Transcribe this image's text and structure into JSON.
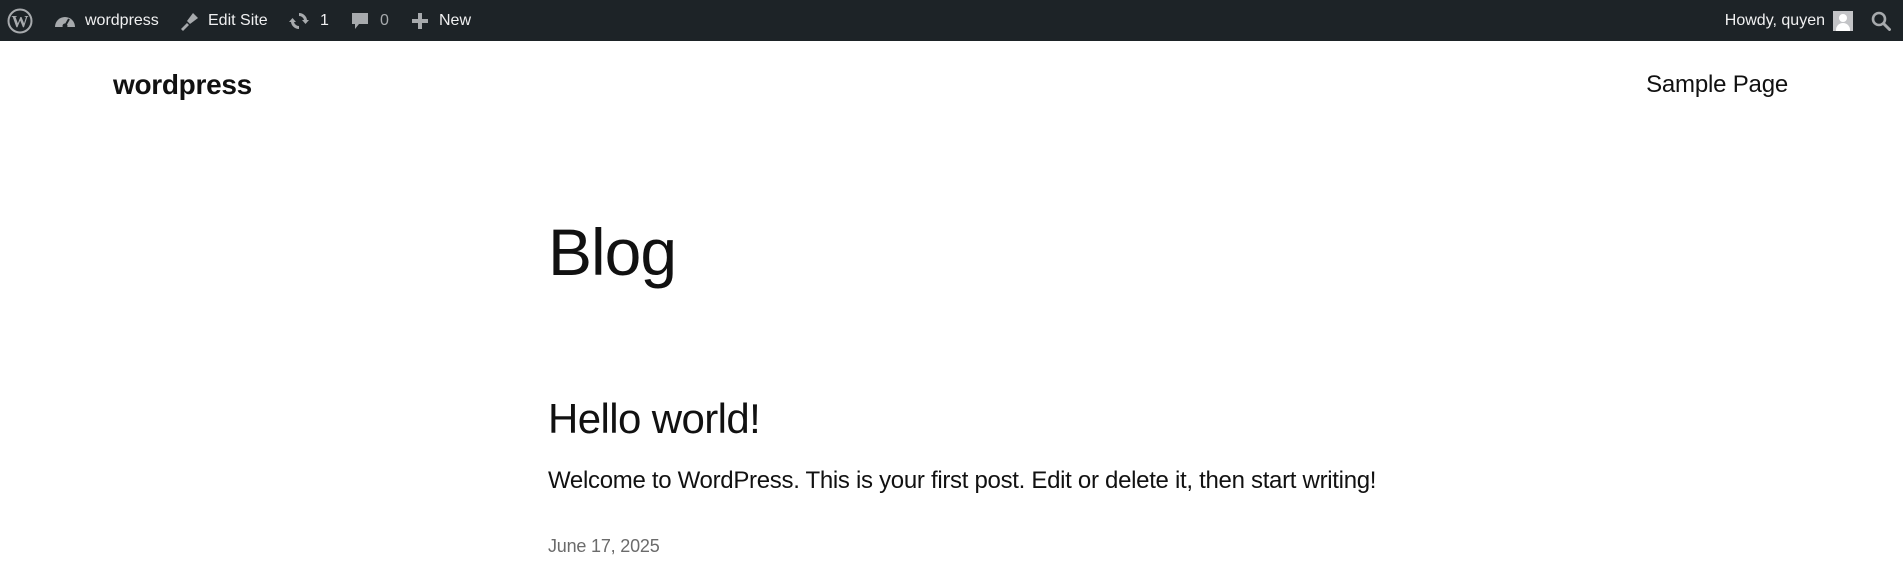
{
  "adminbar": {
    "site_name": "wordpress",
    "edit_site": "Edit Site",
    "updates_count": "1",
    "comments_count": "0",
    "new_label": "New",
    "greeting": "Howdy, quyen"
  },
  "site": {
    "title": "wordpress",
    "nav_items": [
      "Sample Page"
    ]
  },
  "main": {
    "page_title": "Blog",
    "posts": [
      {
        "title": "Hello world!",
        "excerpt": "Welcome to WordPress. This is your first post. Edit or delete it, then start writing!",
        "date": "June 17, 2025"
      }
    ]
  },
  "colors": {
    "adminbar_bg": "#1d2327",
    "adminbar_text": "#f0f0f1",
    "muted": "#a7aaad",
    "text": "#111111"
  },
  "icons": [
    "wordpress-logo-icon",
    "dashboard-icon",
    "brush-icon",
    "updates-icon",
    "comment-icon",
    "plus-icon",
    "user-avatar-icon",
    "search-icon"
  ]
}
